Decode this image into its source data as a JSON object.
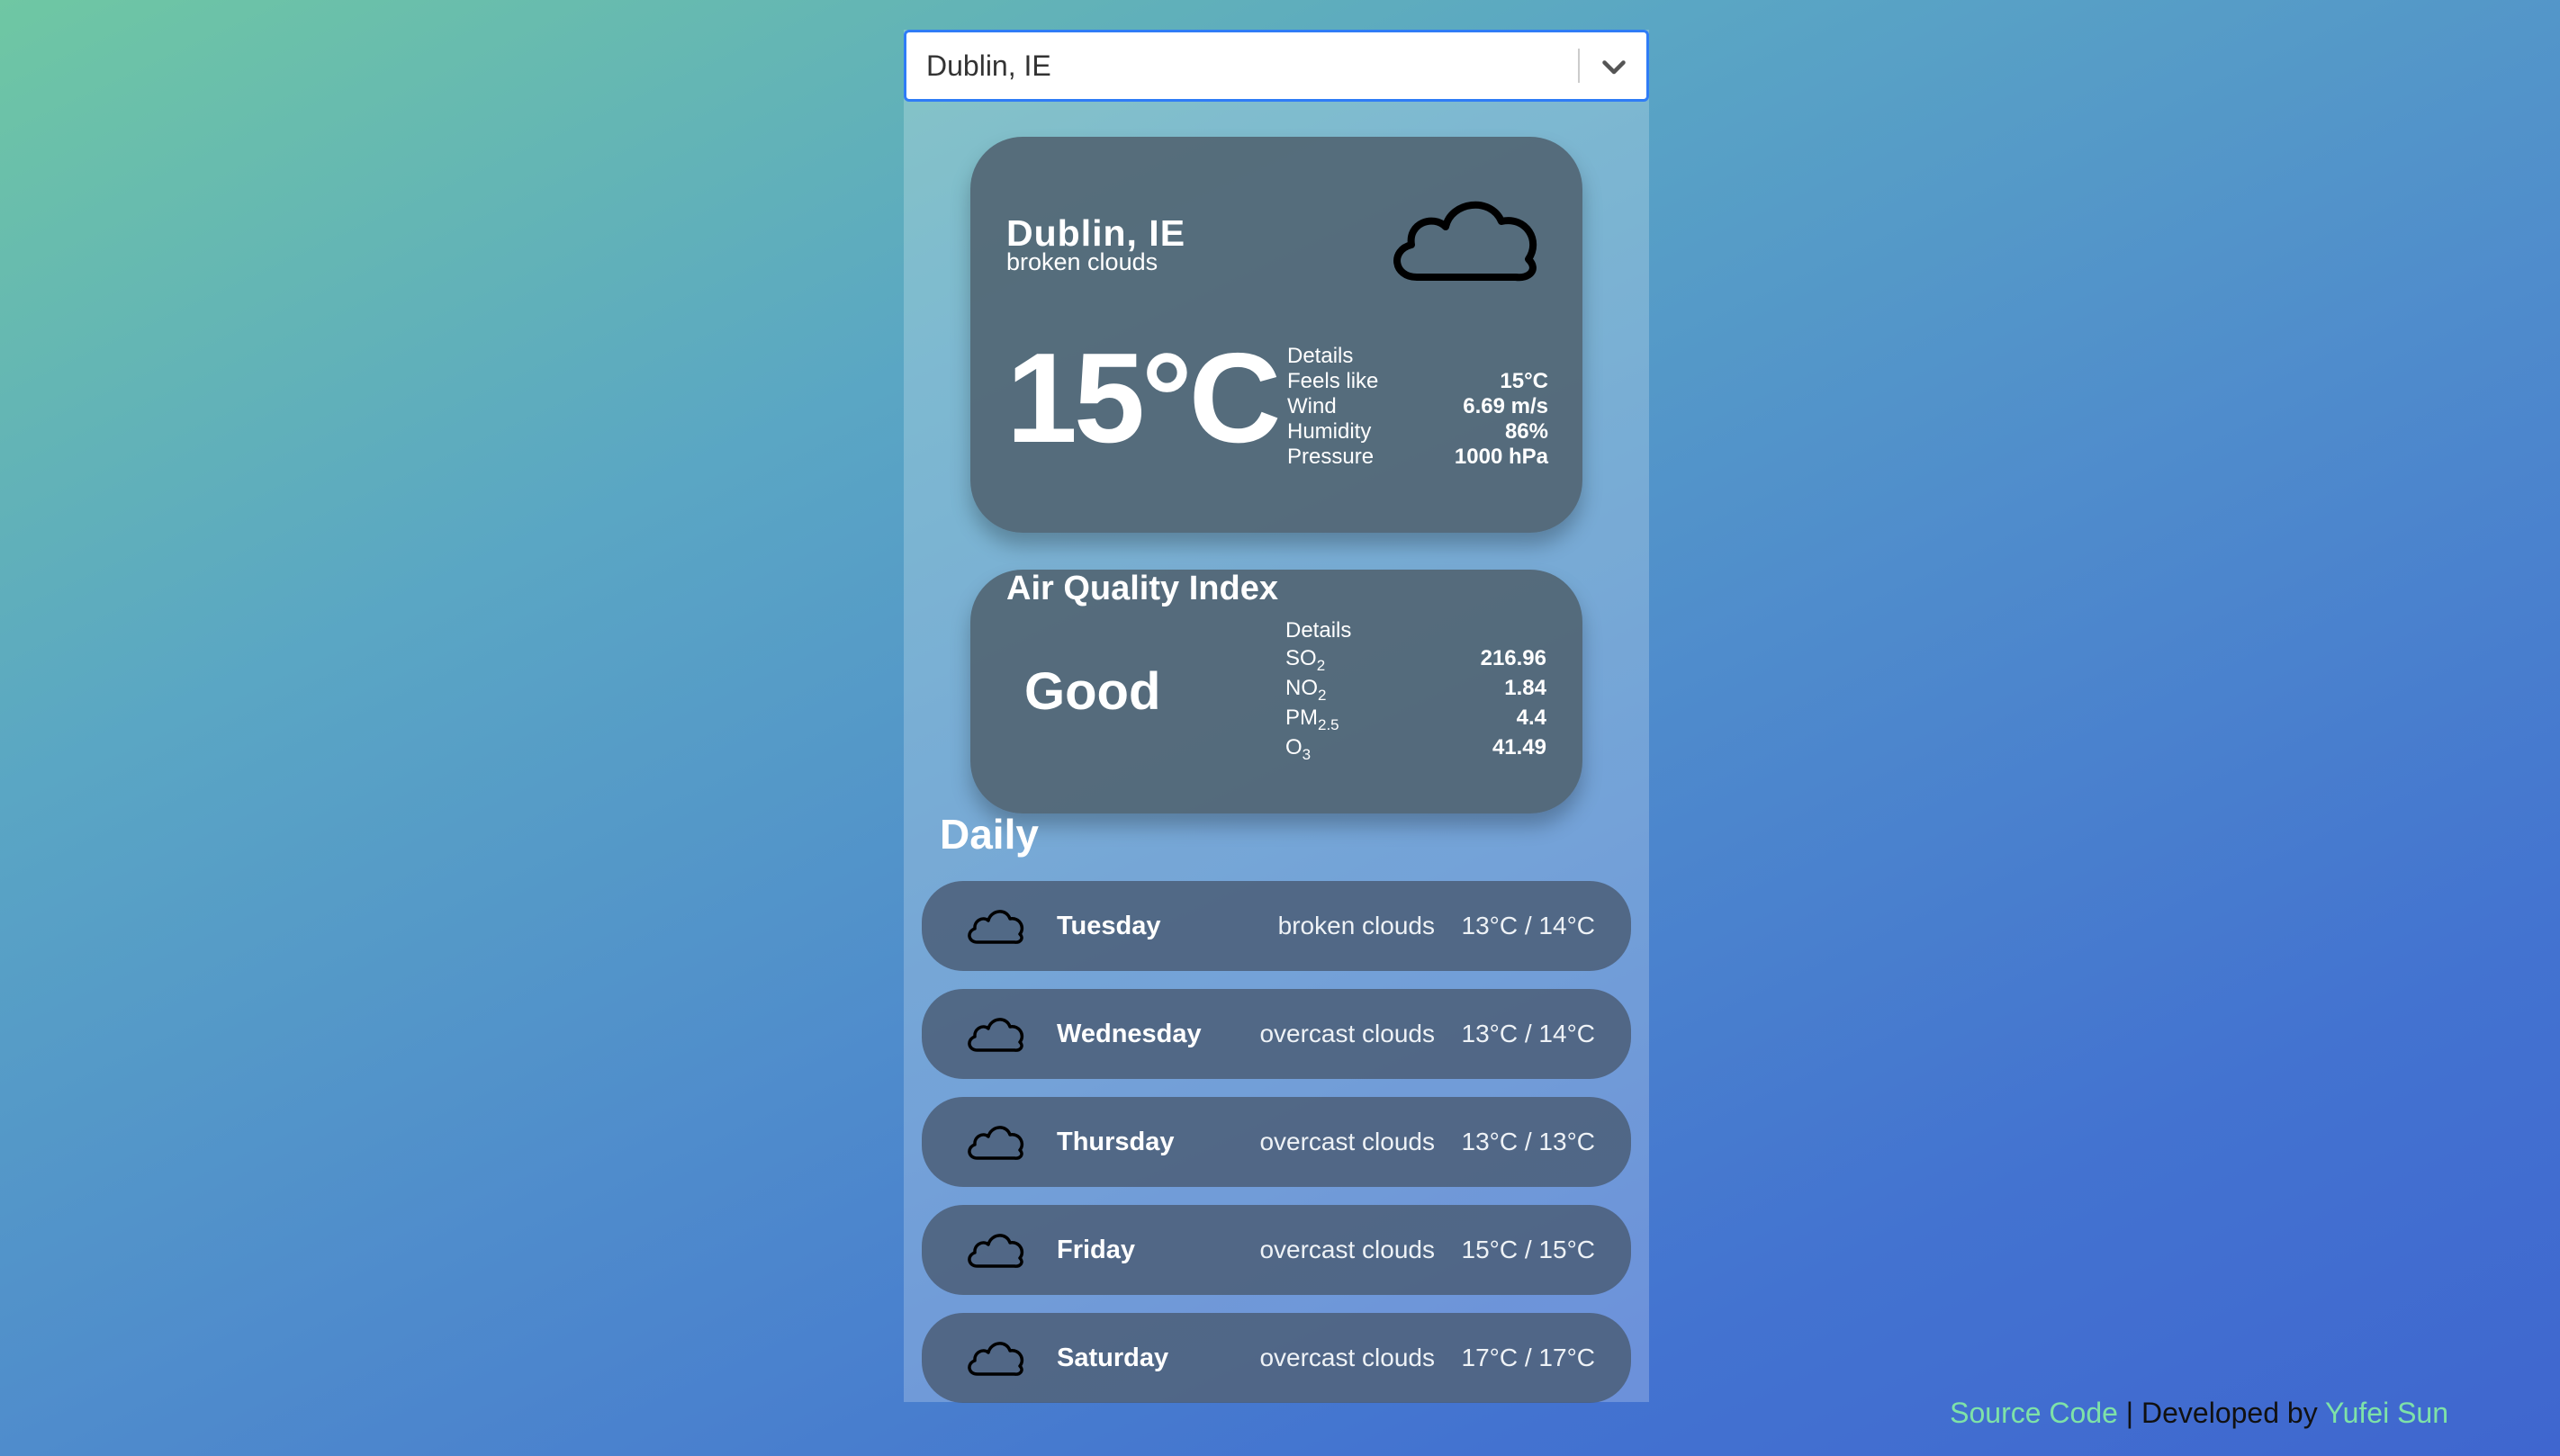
{
  "search": {
    "selected": "Dublin, IE"
  },
  "current": {
    "city": "Dublin, IE",
    "description": "broken clouds",
    "icon": "cloud-icon",
    "temperature": "15°C",
    "details_label": "Details",
    "details": [
      {
        "label": "Feels like",
        "value": "15°C"
      },
      {
        "label": "Wind",
        "value": "6.69 m/s"
      },
      {
        "label": "Humidity",
        "value": "86%"
      },
      {
        "label": "Pressure",
        "value": "1000 hPa"
      }
    ]
  },
  "aqi": {
    "title": "Air Quality Index",
    "rating": "Good",
    "details_label": "Details",
    "pollutants": [
      {
        "base": "SO",
        "sub": "2",
        "value": "216.96"
      },
      {
        "base": "NO",
        "sub": "2",
        "value": "1.84"
      },
      {
        "base": "PM",
        "sub": "2.5",
        "value": "4.4"
      },
      {
        "base": "O",
        "sub": "3",
        "value": "41.49"
      }
    ]
  },
  "daily": {
    "title": "Daily",
    "days": [
      {
        "name": "Tuesday",
        "description": "broken clouds",
        "temp": "13°C / 14°C",
        "icon": "cloud-icon"
      },
      {
        "name": "Wednesday",
        "description": "overcast clouds",
        "temp": "13°C / 14°C",
        "icon": "cloud-icon"
      },
      {
        "name": "Thursday",
        "description": "overcast clouds",
        "temp": "13°C / 13°C",
        "icon": "cloud-icon"
      },
      {
        "name": "Friday",
        "description": "overcast clouds",
        "temp": "15°C / 15°C",
        "icon": "cloud-icon"
      },
      {
        "name": "Saturday",
        "description": "overcast clouds",
        "temp": "17°C / 17°C",
        "icon": "cloud-icon"
      }
    ]
  },
  "footer": {
    "source_link": "Source Code",
    "separator": " | Developed by ",
    "author_link": "Yufei Sun"
  },
  "colors": {
    "link": "#7ee2a8",
    "select_border": "#2f7cf6",
    "card": "#506270"
  }
}
